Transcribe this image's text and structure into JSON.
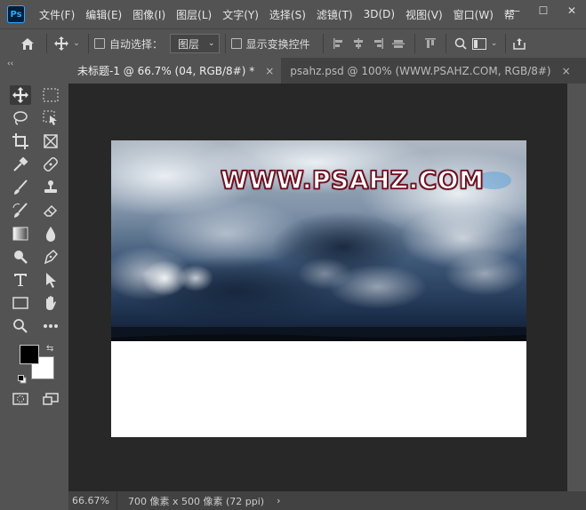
{
  "app": {
    "logo": "Ps"
  },
  "menu": [
    "文件(F)",
    "编辑(E)",
    "图像(I)",
    "图层(L)",
    "文字(Y)",
    "选择(S)",
    "滤镜(T)",
    "3D(D)",
    "视图(V)",
    "窗口(W)",
    "帮"
  ],
  "window_controls": {
    "minimize": "—",
    "restore": "☐",
    "close": "✕"
  },
  "options": {
    "auto_select_label": "自动选择：",
    "layer_dropdown": "图层",
    "show_transform_label": "显示变换控件"
  },
  "tools_collapse": "‹‹",
  "tabs": [
    {
      "label": "未标题-1 @ 66.7% (04, RGB/8#) *",
      "close": "×",
      "active": true
    },
    {
      "label": "psahz.psd @ 100% (WWW.PSAHZ.COM, RGB/8#)",
      "close": "×",
      "active": false
    }
  ],
  "document": {
    "watermark": "WWW.PSAHZ.COM"
  },
  "status": {
    "zoom": "66.67%",
    "info": "700 像素 x 500 像素 (72 ppi)",
    "arrow": "›"
  },
  "colors": {
    "foreground": "#000000",
    "background": "#ffffff",
    "accent": "#31a8ff"
  }
}
